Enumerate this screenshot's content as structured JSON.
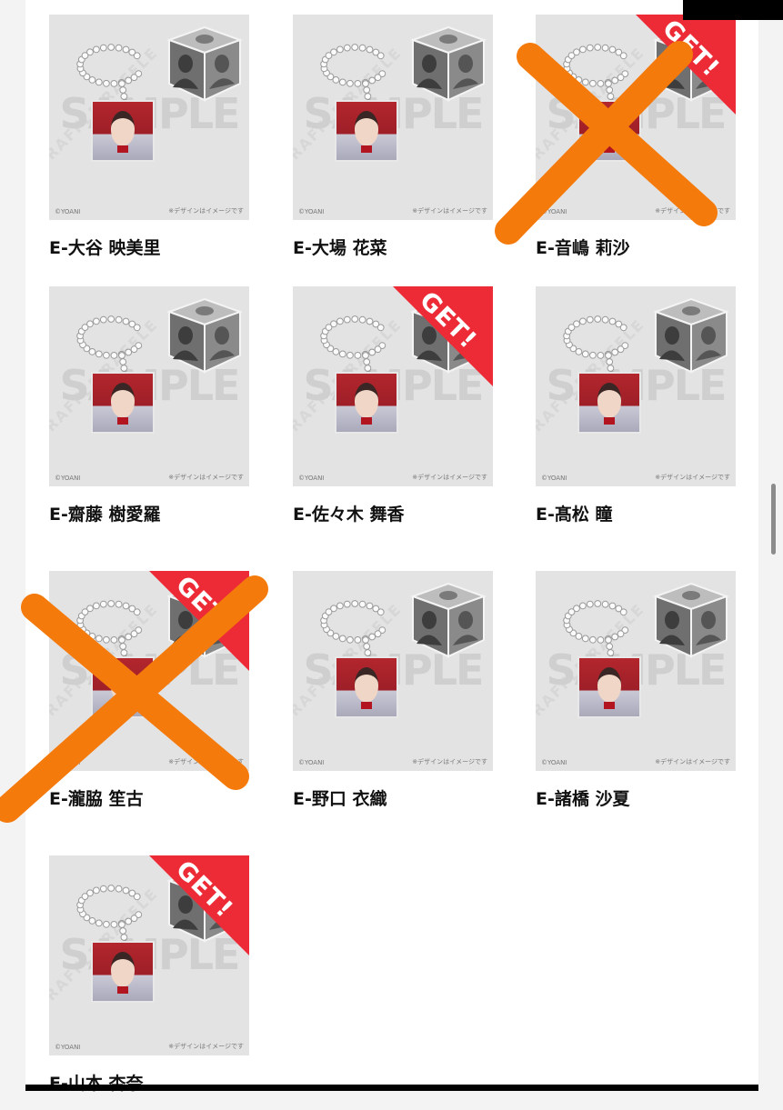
{
  "watermark": "SAMPLE",
  "raffle_text": "RAFFLE RAFFLE",
  "copyright": "©YOANI",
  "design_note": "※デザインはイメージです",
  "badge_text": "GET!",
  "colors": {
    "badge": "#ec2b36",
    "strike": "#f57a0c",
    "thumb_bg": "#e3e3e3"
  },
  "items": [
    {
      "name": "E-大谷 映美里",
      "get": false,
      "crossed": false
    },
    {
      "name": "E-大場 花菜",
      "get": false,
      "crossed": false
    },
    {
      "name": "E-音嶋 莉沙",
      "get": true,
      "crossed": true
    },
    {
      "name": "E-齋藤 樹愛羅",
      "get": false,
      "crossed": false
    },
    {
      "name": "E-佐々木 舞香",
      "get": true,
      "crossed": false
    },
    {
      "name": "E-髙松 瞳",
      "get": false,
      "crossed": false
    },
    {
      "name": "E-瀧脇 笙古",
      "get": true,
      "crossed": true
    },
    {
      "name": "E-野口 衣織",
      "get": false,
      "crossed": false
    },
    {
      "name": "E-諸橋 沙夏",
      "get": false,
      "crossed": false
    },
    {
      "name": "E-山本 杏奈",
      "get": true,
      "crossed": false
    }
  ]
}
